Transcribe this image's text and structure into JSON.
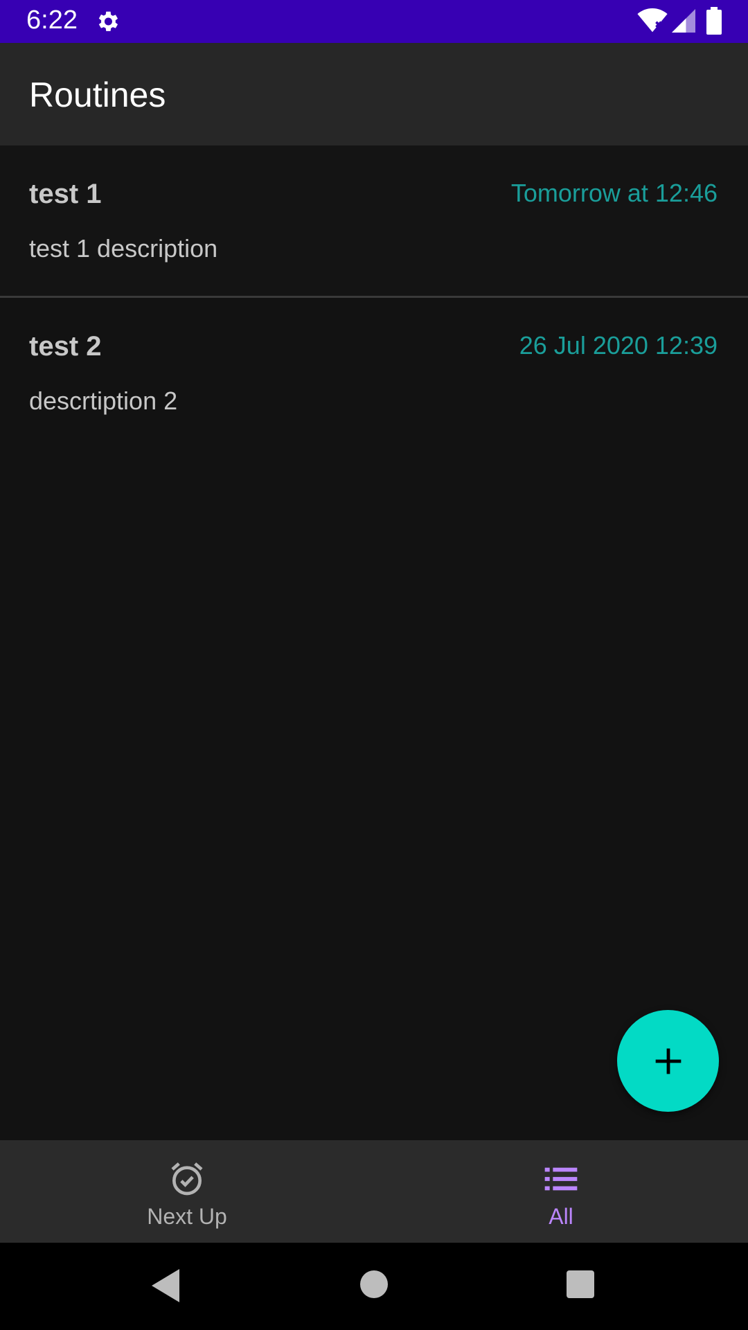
{
  "status_bar": {
    "time": "6:22",
    "icons": [
      "gear-icon",
      "wifi-icon",
      "signal-icon",
      "battery-icon"
    ]
  },
  "app_bar": {
    "title": "Routines"
  },
  "routines": [
    {
      "title": "test 1",
      "date": "Tomorrow at 12:46",
      "description": "test 1 description"
    },
    {
      "title": "test 2",
      "date": "26 Jul 2020 12:39",
      "description": "descrtiption 2"
    }
  ],
  "fab": {
    "icon": "plus-icon"
  },
  "bottom_nav": {
    "items": [
      {
        "label": "Next Up",
        "icon": "alarm-check-icon",
        "selected": false
      },
      {
        "label": "All",
        "icon": "list-icon",
        "selected": true
      }
    ]
  },
  "system_nav": {
    "icons": [
      "back-icon",
      "home-icon",
      "recents-icon"
    ]
  },
  "colors": {
    "status_bar": "#3700b3",
    "app_bar": "#272727",
    "background": "#121212",
    "accent_teal": "#03dac5",
    "date_text": "#1a9e9a",
    "selected_nav": "#bb86fc"
  }
}
